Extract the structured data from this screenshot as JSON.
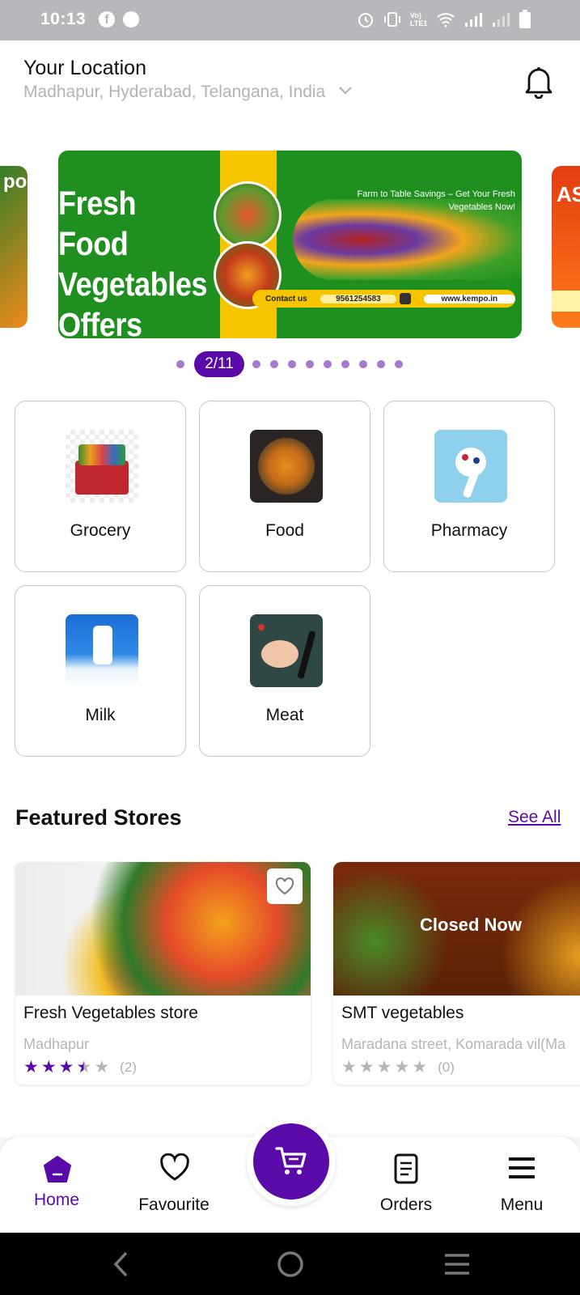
{
  "status_bar": {
    "time": "10:13",
    "lte_label": "Vo) LTE1"
  },
  "header": {
    "title": "Your Location",
    "address": "Madhapur, Hyderabad, Telangana, India"
  },
  "banner": {
    "headline": "Fresh Food Vegetables Offers",
    "tagline": "Farm to Table Savings – Get Your Fresh Vegetables Now!",
    "contact_label": "Contact us",
    "phone": "9561254583",
    "website": "www.kempo.in",
    "side_right_text": "ASH",
    "side_left_text": "po"
  },
  "carousel": {
    "indicator": "2/11"
  },
  "categories": [
    {
      "label": "Grocery"
    },
    {
      "label": "Food"
    },
    {
      "label": "Pharmacy"
    },
    {
      "label": "Milk"
    },
    {
      "label": "Meat"
    }
  ],
  "featured": {
    "title": "Featured Stores",
    "see_all": "See All",
    "stores": [
      {
        "name": "Fresh Vegetables store",
        "address": "Madhapur",
        "rating": 3.5,
        "reviews": "(2)"
      },
      {
        "name": "SMT vegetables",
        "address": "Maradana street, Komarada vil(Ma",
        "rating": 0,
        "reviews": "(0)",
        "status": "Closed Now"
      }
    ]
  },
  "bottom_nav": {
    "home": "Home",
    "favourite": "Favourite",
    "orders": "Orders",
    "menu": "Menu"
  },
  "colors": {
    "primary": "#5a0aa8",
    "banner_green": "#1f8f1f",
    "banner_yellow": "#f7c400"
  }
}
